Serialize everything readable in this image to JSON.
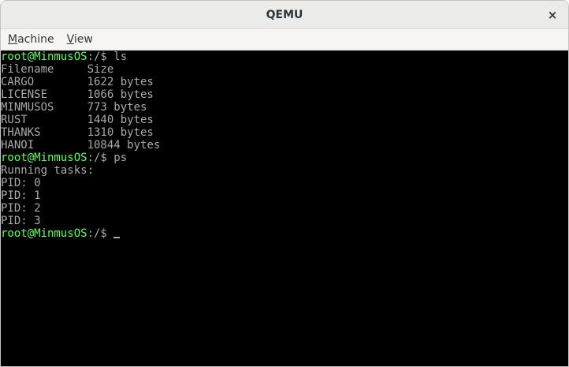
{
  "window": {
    "title": "QEMU",
    "close_glyph": "×"
  },
  "menu": {
    "machine": {
      "mnemonic": "M",
      "rest": "achine"
    },
    "view": {
      "mnemonic": "V",
      "rest": "iew"
    }
  },
  "terminal": {
    "colors": {
      "background": "#000000",
      "text": "#aaaaaa",
      "prompt": "#55ff55"
    },
    "prompt": "root@MinmusOS",
    "lines": [
      {
        "prompt": "root@MinmusOS",
        "text": ":/$ ls"
      },
      {
        "text": "Filename     Size"
      },
      {
        "text": "CARGO        1622 bytes"
      },
      {
        "text": "LICENSE      1066 bytes"
      },
      {
        "text": "MINMUSOS     773 bytes"
      },
      {
        "text": "RUST         1440 bytes"
      },
      {
        "text": "THANKS       1310 bytes"
      },
      {
        "text": "HANOI        10844 bytes"
      },
      {
        "prompt": "root@MinmusOS",
        "text": ":/$ ps"
      },
      {
        "text": "Running tasks:"
      },
      {
        "text": "PID: 0"
      },
      {
        "text": "PID: 1"
      },
      {
        "text": "PID: 2"
      },
      {
        "text": "PID: 3"
      },
      {
        "prompt": "root@MinmusOS",
        "text": ":/$ ",
        "cursor": true
      }
    ]
  }
}
